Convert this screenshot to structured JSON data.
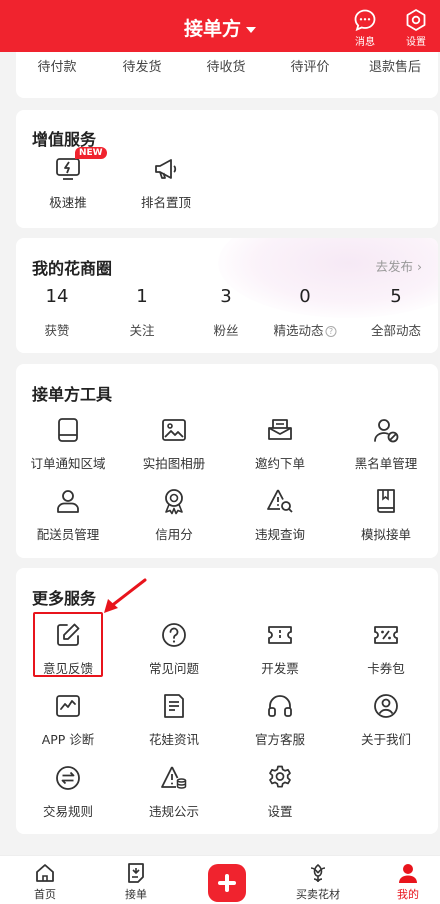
{
  "header": {
    "title": "接单方",
    "messages_label": "消息",
    "settings_label": "设置"
  },
  "orders": [
    "待付款",
    "待发货",
    "待收货",
    "待评价",
    "退款售后"
  ],
  "value_added": {
    "title": "增值服务",
    "badge": "NEW",
    "items": [
      "极速推",
      "排名置顶"
    ]
  },
  "circle": {
    "title": "我的花商圈",
    "publish_link": "去发布 ›",
    "stats": [
      {
        "value": "14",
        "label": "获赞"
      },
      {
        "value": "1",
        "label": "关注"
      },
      {
        "value": "3",
        "label": "粉丝"
      },
      {
        "value": "0",
        "label": "精选动态"
      },
      {
        "value": "5",
        "label": "全部动态"
      }
    ]
  },
  "tools": {
    "title": "接单方工具",
    "items": [
      "订单通知区域",
      "实拍图相册",
      "邀约下单",
      "黑名单管理",
      "配送员管理",
      "信用分",
      "违规查询",
      "模拟接单"
    ]
  },
  "more": {
    "title": "更多服务",
    "items": [
      "意见反馈",
      "常见问题",
      "开发票",
      "卡券包",
      "APP 诊断",
      "花娃资讯",
      "官方客服",
      "关于我们",
      "交易规则",
      "违规公示",
      "设置"
    ]
  },
  "tabbar": {
    "items": [
      "首页",
      "接单",
      "买卖花材",
      "我的"
    ]
  },
  "colors": {
    "brand": "#f0232e",
    "highlight": "#e8141c"
  }
}
